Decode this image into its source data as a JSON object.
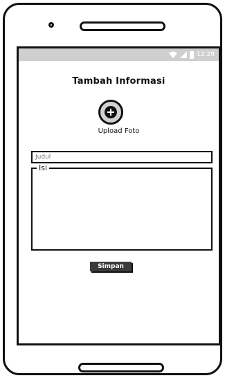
{
  "status_bar": {
    "time": "12:29",
    "icons": [
      "wifi-icon",
      "signal-icon",
      "battery-icon"
    ]
  },
  "page": {
    "title": "Tambah Informasi"
  },
  "upload": {
    "icon": "plus-icon",
    "label": "Upload Foto"
  },
  "form": {
    "title_placeholder": "Judul",
    "content_label": "Isi",
    "save_label": "Simpan"
  },
  "colors": {
    "outline": "#111111",
    "status_bar": "#cfcfcf",
    "upload_fill": "#d2d2d2",
    "button_fill": "#3a3a3a"
  }
}
